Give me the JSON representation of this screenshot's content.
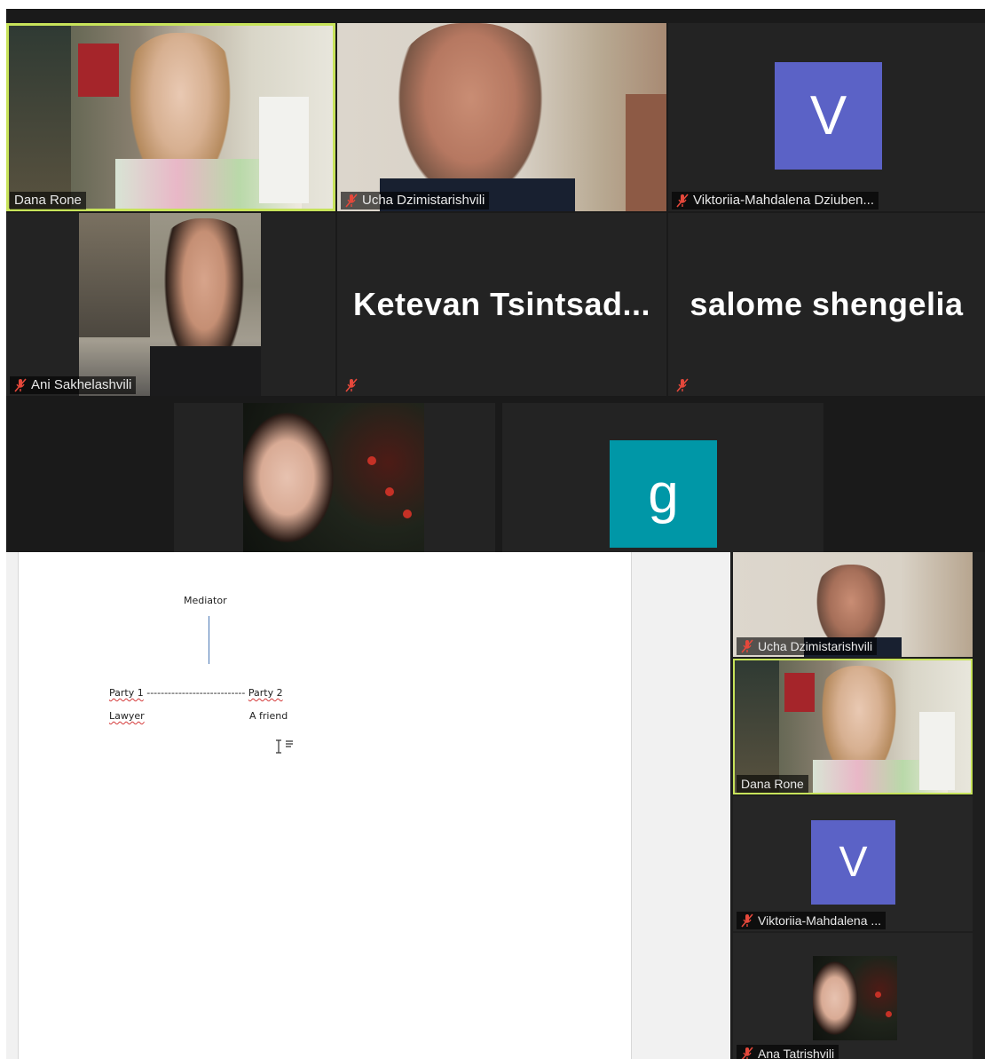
{
  "gallery": {
    "participants": [
      {
        "name": "Dana Rone",
        "muted": false,
        "speaking": true
      },
      {
        "name": "Ucha Dzimistarishvili",
        "muted": true
      },
      {
        "name": "Viktoriia-Mahdalena Dziuben...",
        "muted": true,
        "avatar_letter": "V"
      },
      {
        "name": "Ani Sakhelashvili",
        "muted": true
      },
      {
        "name": "",
        "display_name": "Ketevan  Tsintsad...",
        "muted": true
      },
      {
        "name": "",
        "display_name": "salome shengelia",
        "muted": true
      },
      {
        "name": "",
        "muted": false
      },
      {
        "name": "",
        "avatar_letter": "g",
        "muted": false
      }
    ]
  },
  "document": {
    "mediator": "Mediator",
    "party1": "Party 1",
    "dashes": "----------------------------",
    "party2": "Party 2",
    "lawyer": "Lawyer",
    "friend": "A friend"
  },
  "side_panel": {
    "tiles": [
      {
        "name": "Ucha Dzimistarishvili",
        "muted": true
      },
      {
        "name": "Dana Rone",
        "muted": false,
        "speaking": true
      },
      {
        "name": "Viktoriia-Mahdalena ...",
        "muted": true,
        "avatar_letter": "V"
      },
      {
        "name": "Ana Tatrishvili",
        "muted": true
      }
    ]
  },
  "colors": {
    "active_border": "#c7e35a",
    "avatar_v": "#5b62c6",
    "avatar_g": "#0097a7",
    "mute_red": "#e5483b"
  }
}
